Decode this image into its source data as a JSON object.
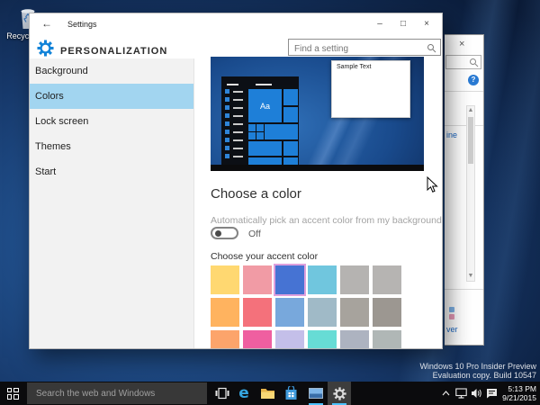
{
  "desktop": {
    "recycle_bin_label": "Recycle Bin",
    "watermark": {
      "line1": "Windows 10 Pro Insider Preview",
      "line2": "Evaluation copy. Build 10547"
    }
  },
  "settings_window": {
    "titlebar": {
      "back": "←",
      "title": "Settings",
      "minimize": "–",
      "maximize": "□",
      "close": "×"
    },
    "header": {
      "title": "PERSONALIZATION",
      "search_placeholder": "Find a setting"
    },
    "sidebar": {
      "items": [
        {
          "label": "Background",
          "selected": false
        },
        {
          "label": "Colors",
          "selected": true
        },
        {
          "label": "Lock screen",
          "selected": false
        },
        {
          "label": "Themes",
          "selected": false
        },
        {
          "label": "Start",
          "selected": false
        }
      ]
    },
    "preview": {
      "sample_window_title": "Sample Text",
      "font_tile_label": "Aa"
    },
    "color_section": {
      "heading": "Choose a color",
      "auto_accent_label": "Automatically pick an accent color from my background",
      "toggle_label": "Off",
      "accent_picker_label": "Choose your accent color",
      "swatches": [
        "#ffd871",
        "#f19ba5",
        "#4673d3",
        "#70c6de",
        "#b5b3b1",
        "#b6b4b2",
        "#ffb35f",
        "#f4717b",
        "#78a8dc",
        "#a0bac7",
        "#a7a39d",
        "#9c9791",
        "#fca46b",
        "#ef5fa0",
        "#c4bfe9",
        "#67dcd5",
        "#adb3c0",
        "#b0b7b6"
      ],
      "selected_swatch_index": 2,
      "selected_swatch_border": "#dfa0dd"
    }
  },
  "background_window": {
    "close": "×",
    "link_fragment_top": "ine",
    "link_fragment_bottom": "ver"
  },
  "taskbar": {
    "search_placeholder": "Search the web and Windows",
    "clock": {
      "time": "5:13 PM",
      "date": "9/21/2015"
    }
  },
  "colors": {
    "accent": "#0078d7",
    "sidebar_highlight": "#a2d5f0",
    "taskbar_bg": "#0b0b0d",
    "wallpaper_base": "#17396b"
  }
}
